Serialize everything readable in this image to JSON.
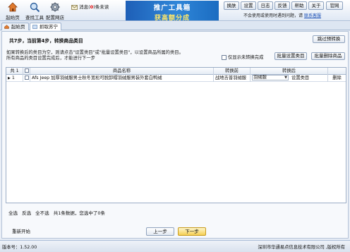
{
  "toolbar": {
    "items": [
      {
        "label": "起始页",
        "icon": "home-icon"
      },
      {
        "label": "查找工具",
        "icon": "search-icon"
      },
      {
        "label": "配置网店",
        "icon": "gear-icon"
      }
    ],
    "message_prefix": "消息(",
    "message_count": "0",
    "message_suffix": ")条未读",
    "banner_line1": "推广工具箱",
    "banner_line2": "获高额分成",
    "menu": [
      "换肤",
      "设置",
      "日志",
      "反馈",
      "帮助",
      "关于",
      "官网"
    ],
    "notice_text": "不会使用或使用时遇到问题，请",
    "notice_link": "联系客服"
  },
  "tabs": [
    {
      "label": "起始页",
      "active": false
    },
    {
      "label": "抓取苏宁",
      "active": true
    }
  ],
  "step": {
    "title": "共7步，当前第4步，转换商品类目",
    "skip_button": "跳过预转换"
  },
  "description": {
    "line1": "如果转换后的类目为空，则请点击\"设置类目\"或\"批量设置类目\"，以设置商品所属的类目。",
    "line2": "所有商品的类目设置完成后，才能进行下一步"
  },
  "actions": {
    "only_untranslated": "仅显示未转换完成",
    "batch_set_category": "批量设置类目",
    "batch_delete": "批量删除商品"
  },
  "grid": {
    "headers": {
      "count": "共 1",
      "name": "商品名称",
      "before": "转换前",
      "after": "转换后"
    },
    "rows": [
      {
        "index": "1",
        "name": "Afs Jeep 加厚羽绒服男士秋冬宽松可脱卸帽羽绒服男装外套白鸭绒",
        "before": "战地吉普羽绒服",
        "after": "羽绒服",
        "set_label": "设置类目",
        "delete_label": "删除"
      }
    ]
  },
  "footer": {
    "select_all": "全选",
    "invert": "反选",
    "select_none": "全不选",
    "summary": "共1条数据，您选中了0条",
    "restart": "重新开始",
    "prev": "上一步",
    "next": "下一步"
  },
  "status": {
    "version": "版本号：1.52.00",
    "copyright": "深圳市华通易点信息技术有限公司 ,版权所有"
  }
}
